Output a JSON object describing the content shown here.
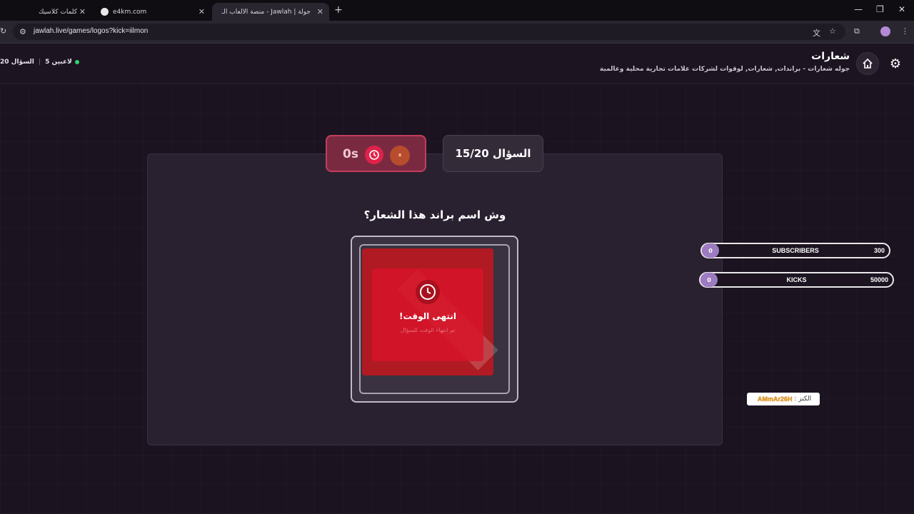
{
  "browser": {
    "tabs": [
      {
        "title": "كلمات كلاسيك"
      },
      {
        "title": "e4km.com"
      },
      {
        "title": "جولة | Jawlah - منصة الألعاب الـ"
      }
    ],
    "url": "jawlah.live/games/logos?kick=iilmon"
  },
  "header": {
    "title": "شعارات",
    "subtitle": "جوله شعارات - براندات, شعارات, لوقوات لشركات علامات تجارية محلية وعالمية",
    "players": "5 لاعبين",
    "question_short": "السؤال 20"
  },
  "game": {
    "timer": "0s",
    "pause_icon": "⏸",
    "question_counter": "السؤال 15/20",
    "question": "وش اسم براند هذا الشعار؟",
    "overlay_title": "انتهى الوقت!",
    "overlay_sub": "تم انتهاء الوقت للسؤال"
  },
  "scoreboard": [
    {
      "rank": "0",
      "name": "SUBSCRIBERS",
      "score": "300"
    },
    {
      "rank": "0",
      "name": "KICKS",
      "score": "50000"
    }
  ],
  "credit": {
    "label": "الكنز :",
    "nick": "AMmAr26H"
  },
  "colors": {
    "background": "#1b1320",
    "accent_red": "#e0224a",
    "accent_purple": "#9c7bc0",
    "online_green": "#2ed36b"
  }
}
